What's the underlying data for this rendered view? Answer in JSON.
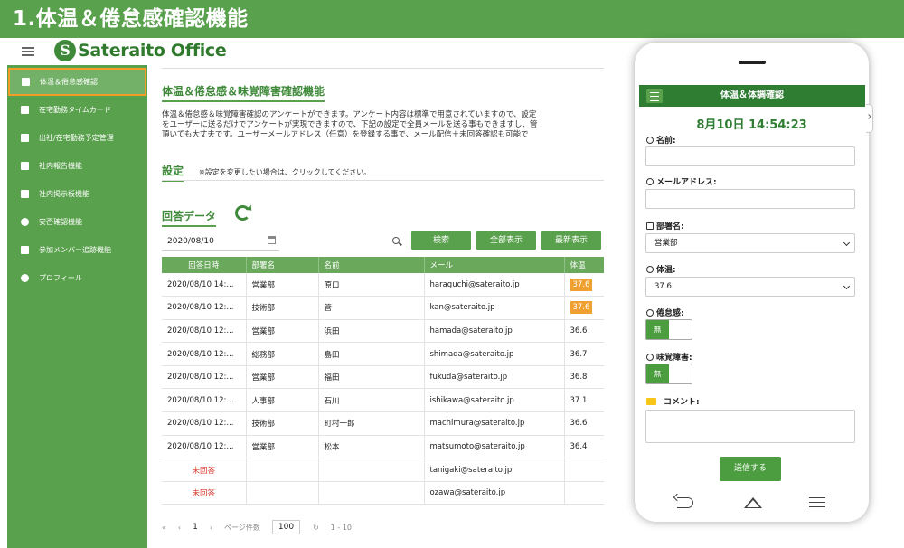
{
  "banner": {
    "title": "1.体温＆倦怠感確認機能"
  },
  "logo": {
    "mark": "S",
    "text": "Sateraito Office"
  },
  "sidebar": {
    "items": [
      {
        "label": "体温＆倦怠感確認",
        "icon": "dashboard-icon"
      },
      {
        "label": "在宅勤務タイムカード",
        "icon": "card-icon"
      },
      {
        "label": "出社/在宅勤務予定管理",
        "icon": "calendar-icon"
      },
      {
        "label": "社内報告機能",
        "icon": "document-icon"
      },
      {
        "label": "社内掲示板機能",
        "icon": "document-icon"
      },
      {
        "label": "安否確認機能",
        "icon": "heart-icon"
      },
      {
        "label": "参加メンバー追跡機能",
        "icon": "tracking-icon"
      },
      {
        "label": "プロフィール",
        "icon": "person-icon"
      }
    ]
  },
  "main": {
    "title": "体温＆倦怠感＆味覚障害確認機能",
    "description": [
      "体温＆倦怠感＆味覚障害確認のアンケートができます。アンケート内容は標準で用意されていますので、設定",
      "をユーザーに送るだけでアンケートが実現できますので、下記の設定で全員メールを送る事もできますし、管",
      "頂いても大丈夫です。ユーザーメールアドレス（任意）を登録する事で、メール配信＋未回答確認も可能で"
    ],
    "settings_title": "設定",
    "settings_note": "※設定を変更したい場合は、クリックしてください。",
    "answers_title": "回答データ",
    "date_value": "2020/08/10",
    "buttons": {
      "search": "検索",
      "show_all": "全部表示",
      "latest": "最新表示"
    },
    "table": {
      "headers": [
        "回答日時",
        "部署名",
        "名前",
        "メール",
        "体温"
      ],
      "rows": [
        [
          "2020/08/10 14:...",
          "営業部",
          "原口",
          "haraguchi@sateraito.jp",
          "37.6"
        ],
        [
          "2020/08/10 12:...",
          "技術部",
          "管",
          "kan@sateraito.jp",
          "37.6"
        ],
        [
          "2020/08/10 12:...",
          "営業部",
          "浜田",
          "hamada@sateraito.jp",
          "36.6"
        ],
        [
          "2020/08/10 12:...",
          "総務部",
          "島田",
          "shimada@sateraito.jp",
          "36.7"
        ],
        [
          "2020/08/10 12:...",
          "営業部",
          "福田",
          "fukuda@sateraito.jp",
          "36.8"
        ],
        [
          "2020/08/10 12:...",
          "人事部",
          "石川",
          "ishikawa@sateraito.jp",
          "37.1"
        ],
        [
          "2020/08/10 12:...",
          "技術部",
          "町村一郎",
          "machimura@sateraito.jp",
          "36.6"
        ],
        [
          "2020/08/10 12:...",
          "営業部",
          "松本",
          "matsumoto@sateraito.jp",
          "36.4"
        ],
        [
          "未回答",
          "",
          "",
          "tanigaki@sateraito.jp",
          ""
        ],
        [
          "未回答",
          "",
          "",
          "ozawa@sateraito.jp",
          ""
        ]
      ],
      "highlight_rows": [
        0,
        1
      ],
      "highlight_color": "#f0a030",
      "unanswered_color": "#d9362c"
    },
    "pager": {
      "first": "«",
      "prev": "‹",
      "page": "1",
      "next": "›",
      "size_label": "ページ件数",
      "size": "100",
      "range": "1 - 10"
    }
  },
  "phone": {
    "header": "体温＆体調確認",
    "datetime": "8月10日 14:54:23",
    "labels": {
      "name": "名前:",
      "email": "メールアドレス:",
      "dept": "部署名:",
      "temp": "体温:",
      "fatigue": "倦怠感:",
      "taste": "味覚障害:",
      "comment": "コメント:"
    },
    "dept_value": "営業部",
    "temp_value": "37.6",
    "fatigue_value": "無",
    "taste_value": "無",
    "submit": "送信する"
  },
  "colors": {
    "brand_green": "#5aa14d",
    "dark_green": "#2e7d32",
    "active_outline": "#f39c26"
  }
}
